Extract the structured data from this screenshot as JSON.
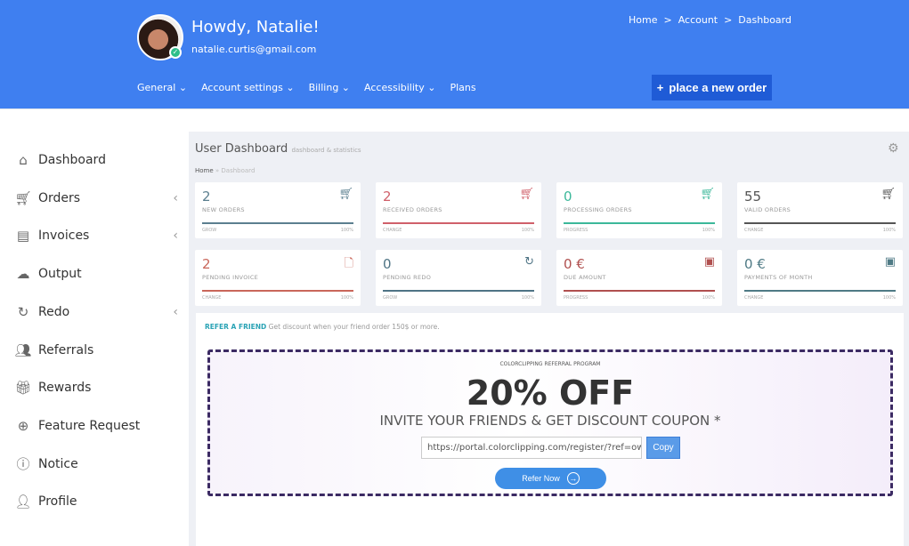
{
  "header": {
    "greeting": "Howdy, Natalie!",
    "email": "natalie.curtis@gmail.com",
    "breadcrumb": "Home  >  Account  >  Dashboard",
    "nav": [
      {
        "label": "General ⌄"
      },
      {
        "label": "Account settings ⌄"
      },
      {
        "label": "Billing ⌄"
      },
      {
        "label": "Accessibility ⌄"
      },
      {
        "label": "Plans"
      }
    ],
    "order_button": "place a new order"
  },
  "sidebar": {
    "items": [
      {
        "label": "Dashboard",
        "icon": "⌂",
        "chev": ""
      },
      {
        "label": "Orders",
        "icon": "🛒︎",
        "chev": "‹"
      },
      {
        "label": "Invoices",
        "icon": "▤",
        "chev": "‹"
      },
      {
        "label": "Output",
        "icon": "☁",
        "chev": ""
      },
      {
        "label": "Redo",
        "icon": "↻",
        "chev": "‹"
      },
      {
        "label": "Referrals",
        "icon": "👥︎",
        "chev": ""
      },
      {
        "label": "Rewards",
        "icon": "🎁︎",
        "chev": ""
      },
      {
        "label": "Feature Request",
        "icon": "⊕",
        "chev": ""
      },
      {
        "label": "Notice",
        "icon": "ⓘ",
        "chev": ""
      },
      {
        "label": "Profile",
        "icon": "👤︎",
        "chev": ""
      }
    ]
  },
  "page": {
    "title": "User Dashboard",
    "subtitle": "dashboard & statistics",
    "crumb_home": "Home",
    "crumb_current": " » Dashboard"
  },
  "cards": [
    {
      "value": "2",
      "label": "NEW ORDERS",
      "sub": "GROW",
      "pct": "100%",
      "color": "#5b7f8f",
      "icon": "🛒︎"
    },
    {
      "value": "2",
      "label": "RECEIVED ORDERS",
      "sub": "CHANGE",
      "pct": "100%",
      "color": "#d0606a",
      "icon": "🛒︎"
    },
    {
      "value": "0",
      "label": "PROCESSING ORDERS",
      "sub": "PROGRESS",
      "pct": "100%",
      "color": "#3cb89a",
      "icon": "🛒︎"
    },
    {
      "value": "55",
      "label": "VALID ORDERS",
      "sub": "CHANGE",
      "pct": "100%",
      "color": "#555555",
      "icon": "🛒︎"
    },
    {
      "value": "2",
      "label": "PENDING INVOICE",
      "sub": "CHANGE",
      "pct": "100%",
      "color": "#c9665a",
      "icon": "🗋"
    },
    {
      "value": "0",
      "label": "PENDING REDO",
      "sub": "GROW",
      "pct": "100%",
      "color": "#4f7485",
      "icon": "↻"
    },
    {
      "value": "0 €",
      "label": "DUE AMOUNT",
      "sub": "PROGRESS",
      "pct": "100%",
      "color": "#b0504f",
      "icon": "▣"
    },
    {
      "value": "0 €",
      "label": "PAYMENTS OF MONTH",
      "sub": "CHANGE",
      "pct": "100%",
      "color": "#4f7a85",
      "icon": "▣"
    }
  ],
  "refer": {
    "title": "REFER A FRIEND",
    "desc": "Get discount when your friend order 150$ or more.",
    "program": "COLORCLIPPING REFERRAL PROGRAM",
    "headline": "20% OFF",
    "invite": "INVITE YOUR FRIENDS & GET DISCOUNT COUPON *",
    "link": "https://portal.colorclipping.com/register/?ref=owkp",
    "copy": "Copy",
    "refer_now": "Refer Now"
  }
}
